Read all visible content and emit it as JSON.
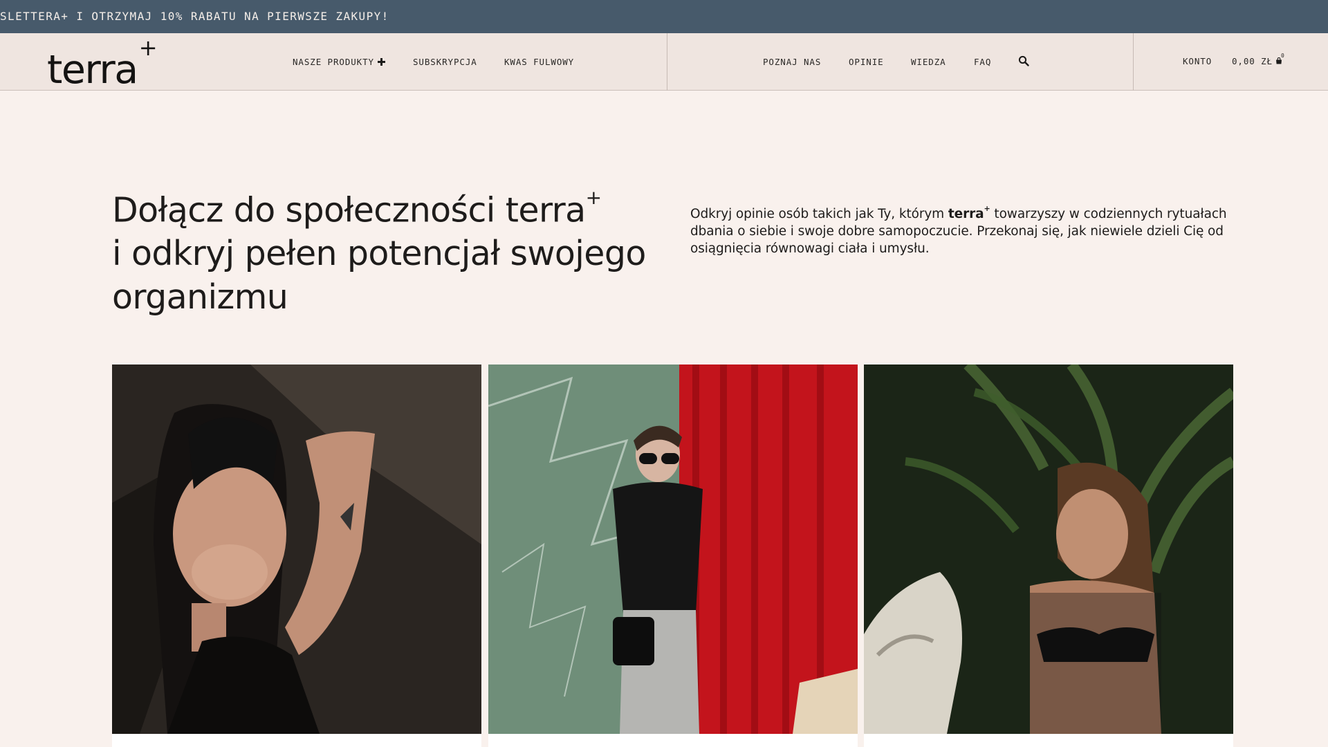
{
  "promo": {
    "text": "SLETTERA+ I OTRZYMAJ 10% RABATU NA PIERWSZE ZAKUPY!"
  },
  "header": {
    "logo": {
      "text": "terra",
      "mark": "+"
    },
    "nav_left": [
      {
        "label": "NASZE PRODUKTY",
        "icon": "plus-icon"
      },
      {
        "label": "SUBSKRYPCJA"
      },
      {
        "label": "KWAS FULWOWY"
      }
    ],
    "nav_right": [
      {
        "label": "POZNAJ NAS"
      },
      {
        "label": "OPINIE"
      },
      {
        "label": "WIEDZA"
      },
      {
        "label": "FAQ"
      }
    ],
    "search_icon": "search-icon",
    "account_label": "KONTO",
    "cart_total": "0,00 ZŁ",
    "cart_count": "0",
    "cart_icon": "bag-icon"
  },
  "hero": {
    "title_line1": "Dołącz do społeczności terra",
    "title_mark": "+",
    "title_line2": "i odkryj pełen potencjał swojego",
    "title_line3": "organizmu",
    "desc_part1": "Odkryj opinie osób takich jak Ty, którym ",
    "desc_brand": "terra",
    "desc_brand_mark": "+",
    "desc_part2": " towarzyszy w codziennych rytuałach dbania o siebie i swoje dobre samopoczucie. Przekonaj się, jak niewiele dzieli Cię od osiągnięcia równowagi ciała i umysłu."
  },
  "colors": {
    "promo_bg": "#475a6b",
    "header_bg": "#efe5e0",
    "page_bg": "#f9f1ed",
    "curtain_red": "#c3141c"
  }
}
